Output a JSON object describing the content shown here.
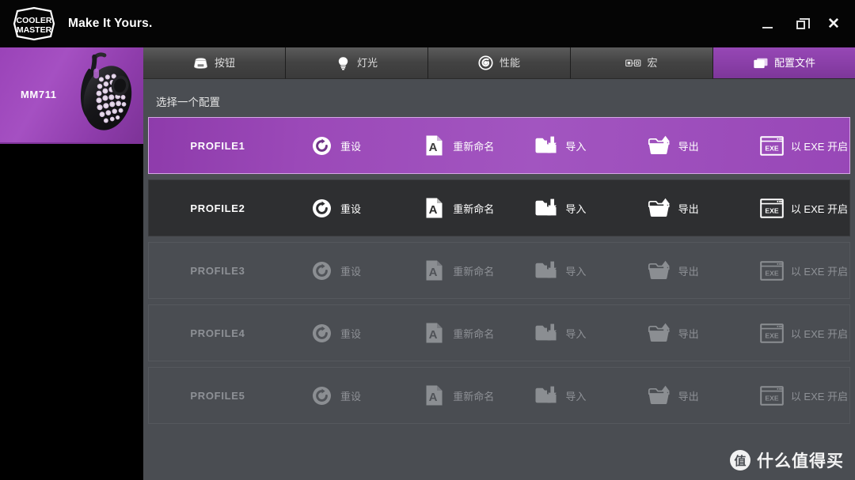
{
  "titlebar": {
    "brand_line1": "COOLER",
    "brand_line2": "MASTER",
    "tagline": "Make It Yours.",
    "minimize_label": "—",
    "maximize_label": "❐",
    "close_label": "✕"
  },
  "sidebar": {
    "device_name": "MM711",
    "device_icon": "gaming-mouse-image"
  },
  "tabs": [
    {
      "label": "按钮",
      "icon": "mouse-buttons-icon",
      "active": false
    },
    {
      "label": "灯光",
      "icon": "lightbulb-icon",
      "active": false
    },
    {
      "label": "性能",
      "icon": "performance-dial-icon",
      "active": false
    },
    {
      "label": "宏",
      "icon": "macro-keys-icon",
      "active": false
    },
    {
      "label": "配置文件",
      "icon": "profile-pages-icon",
      "active": true
    }
  ],
  "main": {
    "section_title": "选择一个配置"
  },
  "actions": {
    "reset": "重设",
    "rename": "重新命名",
    "import": "导入",
    "export": "导出",
    "run_exe": "以 EXE 开启",
    "exe_badge": "EXE",
    "rename_badge": "A"
  },
  "profiles": [
    {
      "name": "PROFILE1",
      "state": "active"
    },
    {
      "name": "PROFILE2",
      "state": "dark"
    },
    {
      "name": "PROFILE3",
      "state": "dim"
    },
    {
      "name": "PROFILE4",
      "state": "dim"
    },
    {
      "name": "PROFILE5",
      "state": "dim"
    }
  ],
  "watermark": {
    "badge": "值",
    "text": "什么值得买"
  },
  "colors": {
    "accent_purple": "#9a43b8",
    "panel_grey": "#4a4d52",
    "row_dark": "#2e2f31",
    "titlebar_black": "#050505"
  }
}
